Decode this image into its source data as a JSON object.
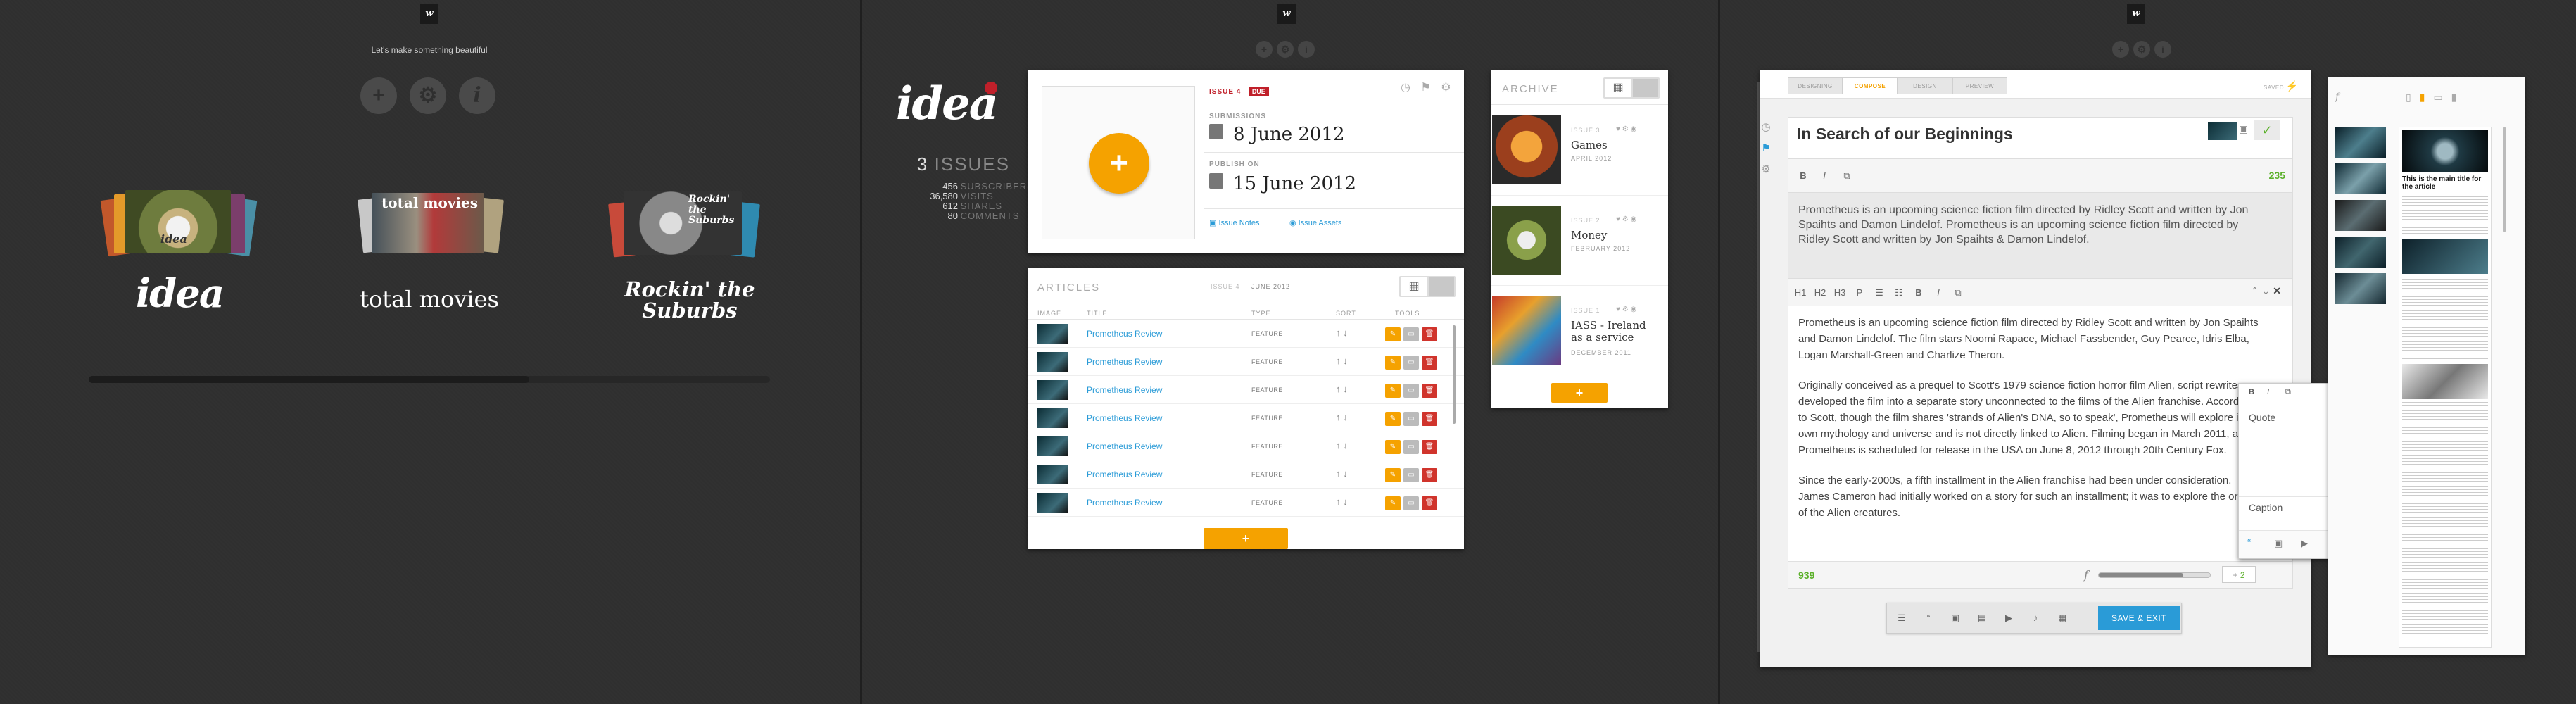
{
  "panel1": {
    "tagline": "Let's make something beautiful",
    "buttons": [
      "+",
      "⚙",
      "i"
    ],
    "publications": [
      {
        "name": "idea"
      },
      {
        "name": "total movies"
      },
      {
        "name": "Rockin' the Suburbs"
      }
    ],
    "cover_texts": {
      "idea": "idea",
      "total": "total movies",
      "rockin": "Rockin' the Suburbs"
    }
  },
  "panel2": {
    "brand": "idea",
    "issues_count": "3",
    "issues_label": "ISSUES",
    "stats": [
      {
        "value": "456",
        "label": "SUBSCRIBERS"
      },
      {
        "value": "36,580",
        "label": "VISITS"
      },
      {
        "value": "612",
        "label": "SHARES"
      },
      {
        "value": "80",
        "label": "COMMENTS"
      }
    ],
    "issue_card": {
      "issue_label": "ISSUE 4",
      "due_badge": "DUE",
      "submissions_label": "SUBMISSIONS",
      "submissions_date": "8 June 2012",
      "publish_label": "PUBLISH ON",
      "publish_date": "15 June 2012",
      "notes_link": "Issue Notes",
      "assets_link": "Issue Assets",
      "add": "+"
    },
    "articles": {
      "title": "ARTICLES",
      "issue": "ISSUE 4",
      "date": "JUNE 2012",
      "headers": [
        "IMAGE",
        "TITLE",
        "TYPE",
        "SORT",
        "TOOLS"
      ],
      "rows": [
        {
          "title": "Prometheus Review",
          "type": "FEATURE"
        },
        {
          "title": "Prometheus Review",
          "type": "FEATURE"
        },
        {
          "title": "Prometheus Review",
          "type": "FEATURE"
        },
        {
          "title": "Prometheus Review",
          "type": "FEATURE"
        },
        {
          "title": "Prometheus Review",
          "type": "FEATURE"
        },
        {
          "title": "Prometheus Review",
          "type": "FEATURE"
        },
        {
          "title": "Prometheus Review",
          "type": "FEATURE"
        }
      ],
      "add": "+"
    },
    "archive": {
      "title": "ARCHIVE",
      "items": [
        {
          "issue": "ISSUE 3",
          "name": "Games",
          "date": "APRIL 2012"
        },
        {
          "issue": "ISSUE 2",
          "name": "Money",
          "date": "FEBRUARY 2012"
        },
        {
          "issue": "ISSUE 1",
          "name": "IASS - Ireland as a service",
          "date": "DECEMBER 2011"
        }
      ],
      "add": "+"
    }
  },
  "panel3": {
    "tabs": [
      "DESIGNING",
      "COMPOSE",
      "DESIGN",
      "PREVIEW"
    ],
    "saved": "SAVED",
    "doc_title": "In Search of our Beginnings",
    "title_count": "235",
    "intro_text": "Prometheus is an upcoming science fiction film directed by Ridley Scott and written by Jon Spaihts and Damon Lindelof. Prometheus is an upcoming science fiction film directed by Ridley Scott and written by Jon Spaihts & Damon Lindelof.",
    "format_buttons": [
      "H1",
      "H2",
      "H3",
      "P",
      "☰",
      "☷",
      "B",
      "I",
      "⧉"
    ],
    "body_paragraphs": [
      "Prometheus is an upcoming science fiction film directed by Ridley Scott and written by Jon Spaihts and Damon Lindelof. The film stars Noomi Rapace, Michael Fassbender, Guy Pearce, Idris Elba, Logan Marshall-Green and Charlize Theron.",
      "Originally conceived as a prequel to Scott's 1979 science fiction horror film Alien, script rewrites developed the film into a separate story unconnected to the films of the Alien franchise. According to Scott, though the film shares 'strands of Alien's DNA, so to speak', Prometheus will explore its own mythology and universe and is not directly linked to Alien. Filming began in March 2011, and Prometheus is scheduled for release in the USA on June 8, 2012 through 20th Century Fox.",
      "Since the early-2000s, a fifth installment in the Alien franchise had been under consideration. James Cameron had initially worked on a story for such an installment; it was to explore the origins of the Alien creatures."
    ],
    "body_count": "939",
    "slider_count": "2",
    "popup": {
      "quote_placeholder": "Quote",
      "caption_placeholder": "Caption"
    },
    "save_exit": "SAVE & EXIT",
    "preview_headline": "This is the main title for the article"
  }
}
